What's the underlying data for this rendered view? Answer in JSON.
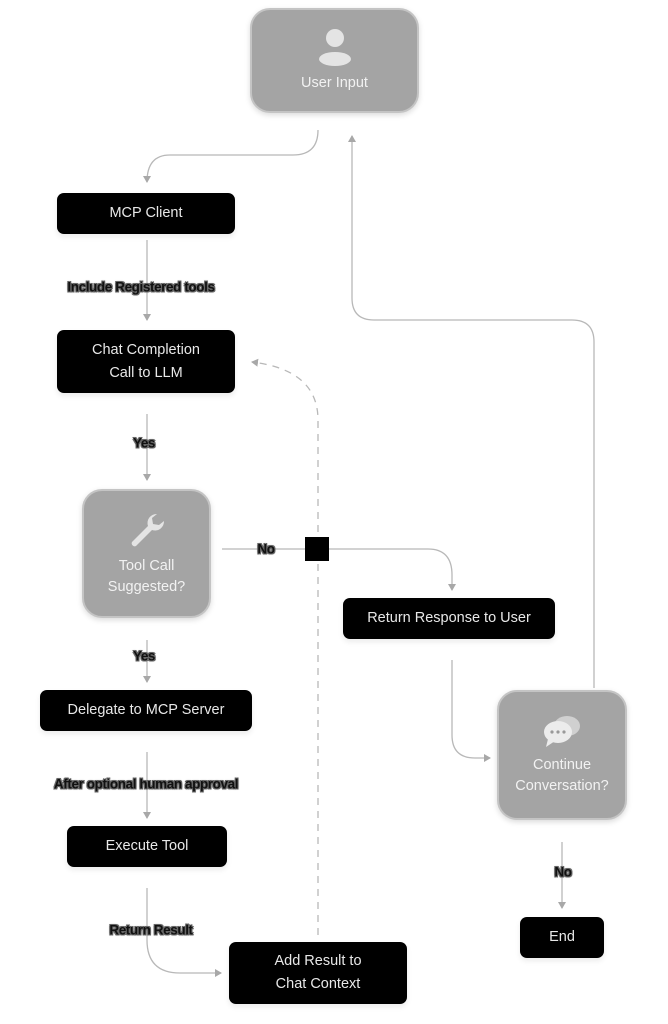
{
  "nodes": {
    "user_input": {
      "label": "User Input",
      "icon": "user-icon"
    },
    "mcp_client": {
      "label": "MCP Client"
    },
    "chat_completion": {
      "line1": "Chat Completion",
      "line2": "Call to LLM"
    },
    "tool_call": {
      "line1": "Tool Call",
      "line2": "Suggested?",
      "icon": "wrench-icon"
    },
    "return_response": {
      "label": "Return Response to User"
    },
    "delegate": {
      "label": "Delegate to MCP Server"
    },
    "execute_tool": {
      "label": "Execute Tool"
    },
    "add_result": {
      "line1": "Add Result to",
      "line2": "Chat Context"
    },
    "continue": {
      "line1": "Continue",
      "line2": "Conversation?",
      "icon": "chat-bubbles-icon"
    },
    "end": {
      "label": "End"
    }
  },
  "edge_labels": {
    "include_tools": "Include Registered tools",
    "yes_1": "Yes",
    "no_1": "No",
    "yes_2": "Yes",
    "approval": "After optional human approval",
    "return_result": "Return Result",
    "no_2": "No"
  },
  "colors": {
    "dark_node": "#000000",
    "gray_node": "#a4a4a4",
    "edge": "#b5b5b5"
  }
}
